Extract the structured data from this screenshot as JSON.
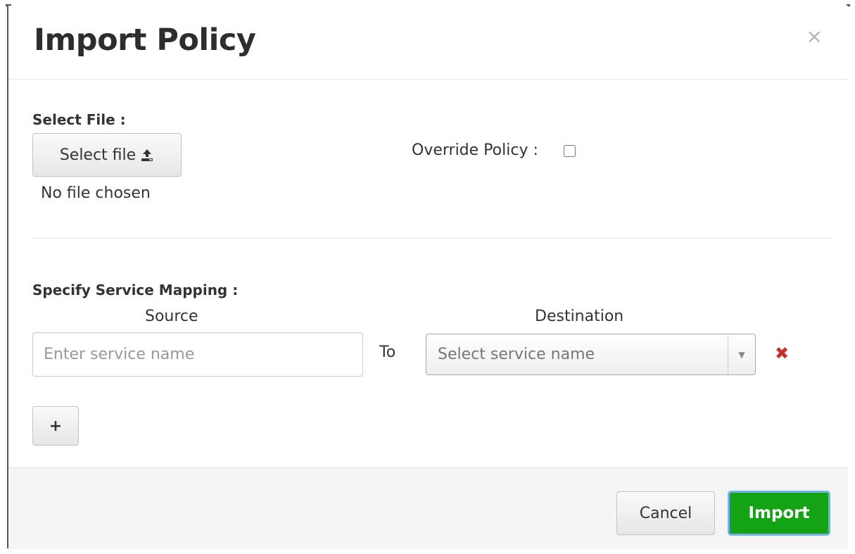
{
  "dialog": {
    "title": "Import Policy",
    "close_symbol": "×"
  },
  "select_file": {
    "label": "Select File :",
    "button_label": "Select file",
    "button_icon": "upload-icon",
    "status": "No file chosen"
  },
  "override": {
    "label": "Override Policy :",
    "checked": false
  },
  "service_mapping": {
    "label": "Specify Service Mapping :",
    "source_header": "Source",
    "destination_header": "Destination",
    "source_placeholder": "Enter service name",
    "to_label": "To",
    "destination_placeholder": "Select service name",
    "remove_symbol": "✖",
    "add_symbol": "+"
  },
  "footer": {
    "cancel_label": "Cancel",
    "import_label": "Import"
  },
  "colors": {
    "import_button": "#14a314",
    "import_focus_ring": "#6fb3e8",
    "remove_icon": "#c9302c"
  }
}
